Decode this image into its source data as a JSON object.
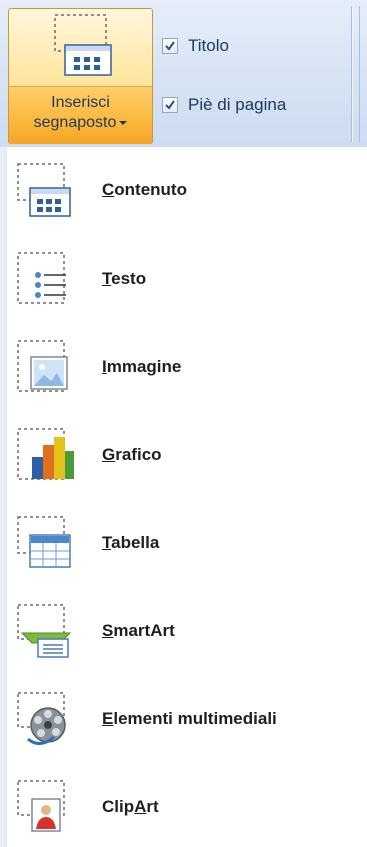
{
  "ribbon": {
    "insert_placeholder_line1": "Inserisci",
    "insert_placeholder_line2": "segnaposto",
    "checkboxes": [
      {
        "label": "Titolo",
        "checked": true
      },
      {
        "label": "Piè di pagina",
        "checked": true
      }
    ]
  },
  "menu": {
    "items": [
      {
        "icon": "content-placeholder-icon",
        "label": "Contenuto",
        "access_key_index": 0
      },
      {
        "icon": "text-placeholder-icon",
        "label": "Testo",
        "access_key_index": 0
      },
      {
        "icon": "picture-placeholder-icon",
        "label": "Immagine",
        "access_key_index": 0
      },
      {
        "icon": "chart-placeholder-icon",
        "label": "Grafico",
        "access_key_index": 0
      },
      {
        "icon": "table-placeholder-icon",
        "label": "Tabella",
        "access_key_index": 0
      },
      {
        "icon": "smartart-placeholder-icon",
        "label": "SmartArt",
        "access_key_index": 0
      },
      {
        "icon": "media-placeholder-icon",
        "label": "Elementi multimediali",
        "access_key_index": 0
      },
      {
        "icon": "clipart-placeholder-icon",
        "label": "ClipArt",
        "access_key_index": 4
      }
    ]
  },
  "colors": {
    "button_hover_top": "#ffe8a8",
    "button_hover_bottom": "#f6a524",
    "ribbon_bg": "#d9e5f5",
    "label_text": "#1e395b"
  }
}
